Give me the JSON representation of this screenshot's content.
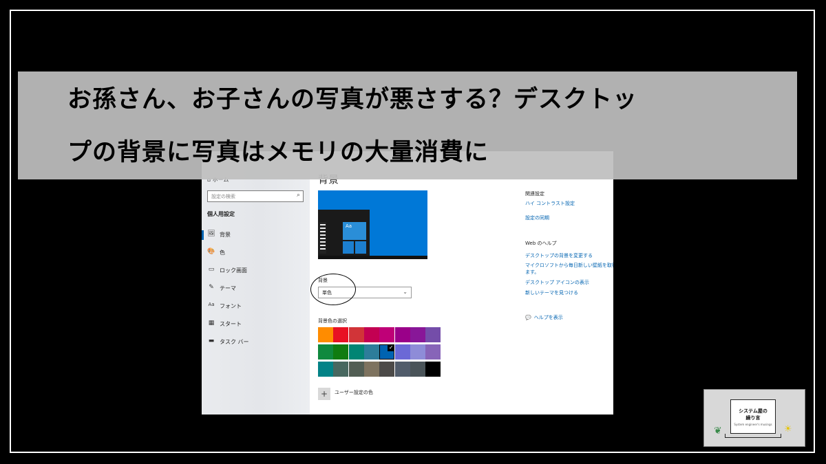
{
  "banner": {
    "line1": "お孫さん、お子さんの写真が悪さする？デスクトッ",
    "line2": "プの背景に写真はメモリの大量消費に"
  },
  "window": {
    "controls": {
      "maximize": "□",
      "close": "×"
    },
    "sidebar": {
      "home": "ホーム",
      "search_placeholder": "設定の検索",
      "section": "個人用設定",
      "items": [
        {
          "icon": "🖼",
          "label": "背景"
        },
        {
          "icon": "🎨",
          "label": "色"
        },
        {
          "icon": "▭",
          "label": "ロック画面"
        },
        {
          "icon": "✎",
          "label": "テーマ"
        },
        {
          "icon": "Aa",
          "label": "フォント"
        },
        {
          "icon": "▦",
          "label": "スタート"
        },
        {
          "icon": "▬",
          "label": "タスク バー"
        }
      ]
    },
    "main": {
      "title": "背景",
      "preview_tile": "Aa",
      "background_label": "背景",
      "background_value": "単色",
      "colors_label": "背景色の選択",
      "swatch_colors": [
        [
          "#ff8c00",
          "#e81123",
          "#d13438",
          "#c30052",
          "#bf0077",
          "#9a0089",
          "#881798",
          "#744da9"
        ],
        [
          "#10893e",
          "#107c10",
          "#018574",
          "#2d7d9a",
          "#0063b1",
          "#6b69d6",
          "#8e8cd8",
          "#8764b8"
        ],
        [
          "#038387",
          "#486860",
          "#525e54",
          "#7e735f",
          "#4c4a48",
          "#515c6b",
          "#4a5459",
          "#000000"
        ]
      ],
      "selected_swatch": "1-4",
      "custom_color_label": "ユーザー設定の色",
      "add_symbol": "+"
    },
    "right": {
      "related_title": "関連設定",
      "related_links": [
        "ハイ コントラスト設定",
        "設定の同期"
      ],
      "help_title": "Web のヘルプ",
      "help_links": [
        "デスクトップの背景を変更する",
        "マイクロソフトから毎日新しい壁紙を取得し",
        "ます。",
        "デスクトップ アイコンの表示",
        "新しいテーマを見つける"
      ],
      "help_show": "ヘルプを表示"
    }
  },
  "logo": {
    "title1": "システム屋の",
    "title2": "繰り言",
    "sub": "System engineer's musings"
  }
}
